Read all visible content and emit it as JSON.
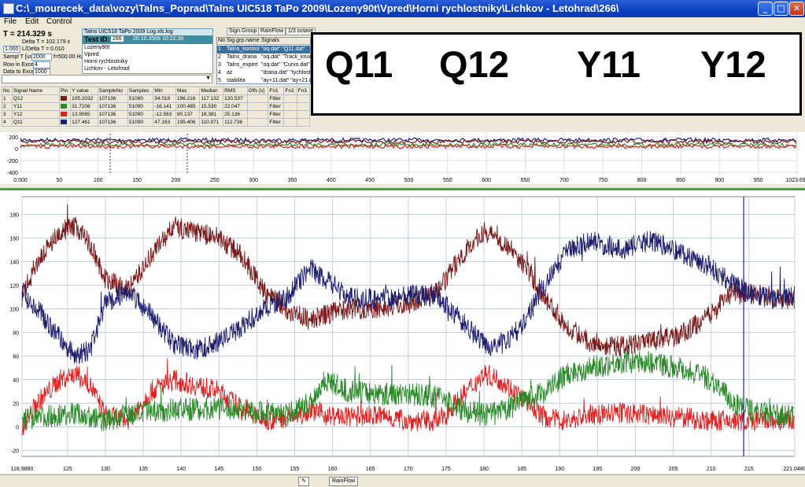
{
  "window": {
    "title": "C:\\_mourecek_data\\vozy\\Talns_Poprad\\Talns UIC518 TaPo 2009\\Lozeny90t\\Vpred\\Horni rychlostniky\\Lichkov - Letohrad\\266\\",
    "min": "_",
    "max": "□",
    "close": "✕"
  },
  "menu": [
    "File",
    "Edit",
    "Control"
  ],
  "info": {
    "t_label": "T = 214.329 s",
    "delta": "Delta T = 102.179 s",
    "ld_value": "1.000",
    "ld_label": "L/Delta T = 0.010",
    "sampl_label": "Sampl T [us]",
    "sampl_value": "2000",
    "hz_label": "f=500.00 Hz",
    "row_label": "Row in Excel",
    "row_value": "4",
    "data_label": "Data to Excel",
    "data_value": "1000"
  },
  "test": {
    "file": "Talns UIC518 TaPo 2009 Log.xls.log",
    "id_label": "Test ID:",
    "id_value": "266",
    "id_date": "20.10.2009 10:22:36",
    "lines": [
      "Lozeny90t",
      "Vpred",
      "Horni rychlostniky",
      "Lichkov - Letohrad"
    ]
  },
  "siglist": {
    "headers": [
      "No",
      "Sig.grp.name",
      "Signals"
    ],
    "rows": [
      [
        "1",
        "Talns_kontrol",
        "\"oq.dat\" \"Q11.dat\""
      ],
      [
        "2",
        "Talns_drana",
        "\"oq.dat\" \"Track_kruv\""
      ],
      [
        "3",
        "Talns_expert",
        "\"oq.dat\" \"Curvo.dat\""
      ],
      [
        "4",
        "az",
        "\"drana.dat\" \"tychlost\""
      ],
      [
        "5",
        "stabilita",
        "\"ay+11.dat\" \"ay+21.dat\""
      ]
    ]
  },
  "tabs": [
    "Sign.Group",
    "RainFlow",
    "1/3 octave",
    "Dist"
  ],
  "legend": [
    {
      "label": "Q11",
      "color": "#1e1e6e"
    },
    {
      "label": "Q12",
      "color": "#7a1a1a"
    },
    {
      "label": "Y11",
      "color": "#2a8a2a"
    },
    {
      "label": "Y12",
      "color": "#e02020"
    }
  ],
  "table": {
    "headers": [
      "No",
      "Signal Name",
      "Pin",
      "Y value",
      "SampleNo",
      "Samples",
      "Min",
      "Max",
      "Median",
      "RMS",
      "Offs [s]",
      "Fn1",
      "Fn2",
      "Fn3"
    ],
    "rows": [
      [
        "1",
        "Q12",
        "#7a1a1a",
        "105.2032",
        "107136",
        "51090",
        "34.019",
        "196.216",
        "117.132",
        "120.537",
        "",
        "Filter",
        "",
        ""
      ],
      [
        "2",
        "Y11",
        "#2a8a2a",
        "31.7208",
        "107136",
        "51090",
        "-16.141",
        "100.485",
        "15.530",
        "22.047",
        "",
        "Filter",
        "",
        ""
      ],
      [
        "3",
        "Y12",
        "#e02020",
        "13.9065",
        "107136",
        "51090",
        "-12.563",
        "80.137",
        "18.381",
        "25.136",
        "",
        "Filter",
        "",
        ""
      ],
      [
        "4",
        "Q11",
        "#1e1e6e",
        "127.461",
        "107136",
        "51090",
        "47.163",
        "195.406",
        "110.971",
        "112.736",
        "",
        "Filter",
        "",
        ""
      ]
    ]
  },
  "overview": {
    "y_ticks": [
      "200",
      "0",
      "-200",
      "-400"
    ],
    "x_ticks": [
      "0.000",
      "50",
      "100",
      "150",
      "200",
      "250",
      "300",
      "350",
      "400",
      "450",
      "500",
      "550",
      "600",
      "650",
      "700",
      "750",
      "800",
      "850",
      "900",
      "950",
      "1023.694"
    ]
  },
  "chart_data": {
    "type": "line",
    "title": "",
    "xlabel": "",
    "ylabel": "",
    "xlim": [
      118.988,
      221.048
    ],
    "ylim": [
      -25,
      195
    ],
    "x_tick_labels": [
      "118.9880",
      "125",
      "130",
      "135",
      "140",
      "145",
      "150",
      "155",
      "160",
      "165",
      "170",
      "175",
      "180",
      "185",
      "190",
      "195",
      "200",
      "205",
      "210",
      "215",
      "221.0480"
    ],
    "y_tick_labels": [
      "180",
      "160",
      "140",
      "120",
      "100",
      "80",
      "60",
      "40",
      "20",
      "0",
      "-20"
    ],
    "x": [
      119,
      121,
      124,
      126,
      128,
      130,
      133,
      136,
      139,
      142,
      145,
      148,
      151,
      154,
      157,
      159,
      162,
      166,
      170,
      174,
      177,
      180,
      182,
      185,
      188,
      191,
      194,
      198,
      202,
      206,
      210,
      213,
      216,
      219,
      221
    ],
    "series": [
      {
        "name": "Q11",
        "color": "#1e1e6e",
        "values": [
          115,
          100,
          75,
          60,
          65,
          105,
          115,
          95,
          70,
          65,
          72,
          85,
          100,
          110,
          135,
          125,
          110,
          108,
          112,
          110,
          90,
          70,
          68,
          85,
          120,
          150,
          158,
          150,
          158,
          148,
          135,
          120,
          110,
          108,
          112
        ]
      },
      {
        "name": "Q12",
        "color": "#7a1a1a",
        "values": [
          110,
          140,
          165,
          170,
          155,
          125,
          115,
          145,
          170,
          165,
          160,
          145,
          115,
          100,
          90,
          95,
          100,
          100,
          105,
          115,
          145,
          165,
          160,
          140,
          110,
          85,
          72,
          68,
          72,
          78,
          95,
          115,
          112,
          110,
          108
        ]
      },
      {
        "name": "Y11",
        "color": "#2a8a2a",
        "values": [
          5,
          8,
          10,
          12,
          8,
          5,
          10,
          12,
          15,
          15,
          15,
          15,
          12,
          10,
          20,
          40,
          30,
          28,
          28,
          25,
          15,
          10,
          12,
          20,
          30,
          45,
          50,
          55,
          55,
          50,
          40,
          20,
          12,
          10,
          8
        ]
      },
      {
        "name": "Y12",
        "color": "#e02020",
        "values": [
          0,
          20,
          40,
          45,
          35,
          10,
          5,
          30,
          40,
          35,
          30,
          15,
          5,
          8,
          15,
          10,
          8,
          10,
          5,
          5,
          25,
          45,
          40,
          25,
          8,
          5,
          10,
          12,
          10,
          8,
          5,
          5,
          5,
          5,
          5
        ]
      }
    ]
  },
  "status": {
    "pen": "✎",
    "rainflow": "RainFlow"
  }
}
